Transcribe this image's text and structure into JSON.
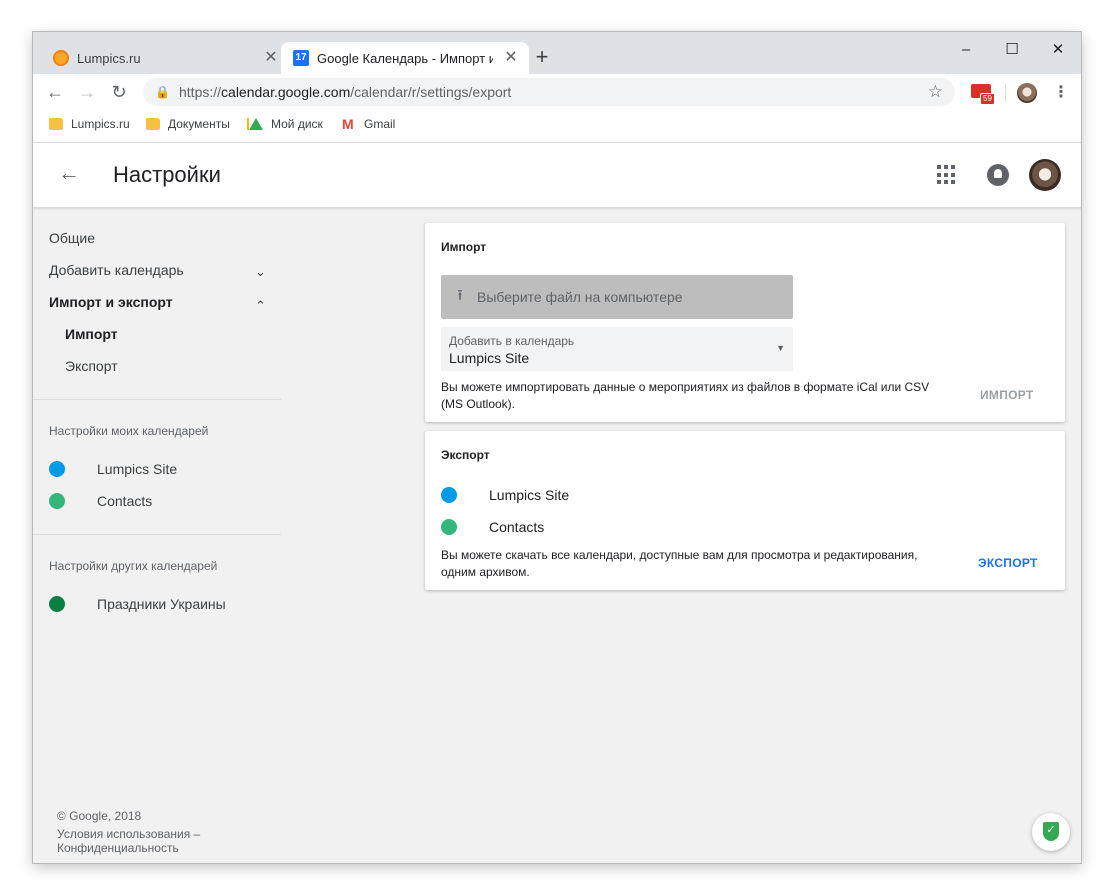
{
  "browser": {
    "tabs": [
      {
        "title": "Lumpics.ru",
        "active": false
      },
      {
        "title": "Google Календарь - Импорт и э",
        "active": true
      }
    ],
    "calendar_favicon_day": "17",
    "new_tab": "+",
    "window_controls": {
      "minimize": "–",
      "maximize": "☐",
      "close": "✕"
    },
    "url": {
      "prefix": "https://",
      "host": "calendar.google.com",
      "path": "/calendar/r/settings/export"
    },
    "mail_badge": "59",
    "bookmarks": [
      "Lumpics.ru",
      "Документы",
      "Мой диск",
      "Gmail"
    ]
  },
  "header": {
    "title": "Настройки"
  },
  "sidebar": {
    "general": "Общие",
    "add_calendar": "Добавить календарь",
    "import_export": "Импорт и экспорт",
    "import": "Импорт",
    "export": "Экспорт",
    "my_calendars_header": "Настройки моих календарей",
    "my_calendars": [
      {
        "name": "Lumpics Site",
        "color": "#039be5"
      },
      {
        "name": "Contacts",
        "color": "#33b679"
      }
    ],
    "other_calendars_header": "Настройки других календарей",
    "other_calendars": [
      {
        "name": "Праздники Украины",
        "color": "#0b8043"
      }
    ],
    "footer": {
      "copyright": "© Google, 2018",
      "terms": "Условия использования –",
      "privacy": "Конфиденциальность"
    }
  },
  "import_card": {
    "title": "Импорт",
    "file_button": "Выберите файл на компьютере",
    "select_label": "Добавить в календарь",
    "select_value": "Lumpics Site",
    "note": "Вы можете импортировать данные о мероприятиях из файлов в формате iCal или CSV (MS Outlook).",
    "action": "ИМПОРТ"
  },
  "export_card": {
    "title": "Экспорт",
    "calendars": [
      {
        "name": "Lumpics Site",
        "color": "#039be5"
      },
      {
        "name": "Contacts",
        "color": "#33b679"
      }
    ],
    "note": "Вы можете скачать все календари, доступные вам для просмотра и редактирования, одним архивом.",
    "action": "ЭКСПОРТ"
  },
  "colors": {
    "accent": "#1a73e8",
    "disabled": "#9aa0a6"
  }
}
